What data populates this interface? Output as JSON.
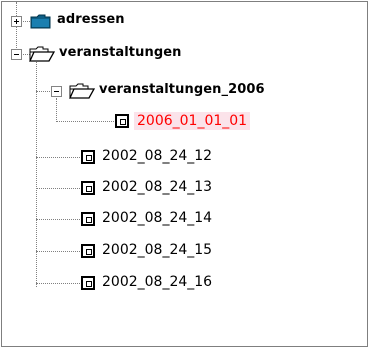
{
  "tree": {
    "root_items": [
      {
        "label": "adressen",
        "expander": "+",
        "icon": "folder-closed-icon"
      },
      {
        "label": "veranstaltungen",
        "expander": "-",
        "icon": "folder-open-icon"
      }
    ],
    "subfolder": {
      "label": "veranstaltungen_2006",
      "expander": "-",
      "icon": "folder-open-icon"
    },
    "selected_item": {
      "label": "2006_01_01_01",
      "icon": "document-icon",
      "color": "#ff0000"
    },
    "items": [
      {
        "label": "2002_08_24_12",
        "icon": "document-icon"
      },
      {
        "label": "2002_08_24_13",
        "icon": "document-icon"
      },
      {
        "label": "2002_08_24_14",
        "icon": "document-icon"
      },
      {
        "label": "2002_08_24_15",
        "icon": "document-icon"
      },
      {
        "label": "2002_08_24_16",
        "icon": "document-icon"
      }
    ]
  }
}
